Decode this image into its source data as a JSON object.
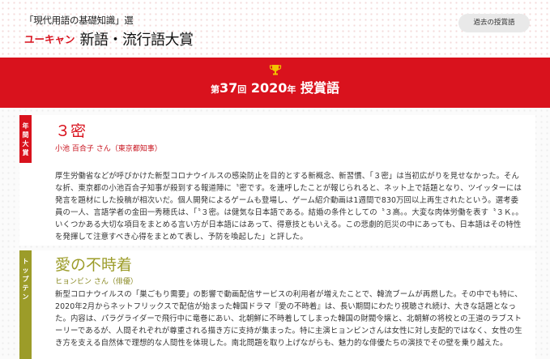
{
  "header": {
    "logo_subtitle": "「現代用語の基礎知識」選",
    "logo_brand": "ユーキャン",
    "logo_title": "新語・流行語大賞",
    "past_awards_button": "過去の授賞語"
  },
  "banner": {
    "edition_prefix": "第",
    "edition_number": "37",
    "edition_suffix": "回",
    "year": "2020",
    "year_suffix": "年",
    "title": "授賞語",
    "icon": "trophy-icon"
  },
  "colors": {
    "brand_red": "#d9121d",
    "olive": "#9c9c29"
  },
  "awards": [
    {
      "category_label": [
        "年",
        "間",
        "大",
        "賞"
      ],
      "word": "３密",
      "winner": "小池 百合子 さん（東京都知事）",
      "description": "厚生労働省などが呼びかけた新型コロナウイルスの感染防止を目的とする新概念、新習慣、「３密」は当初広がりを見せなかった。そんな折、東京都の小池百合子知事が殺到する報道陣に〝密です。を連呼したことが報じられると、ネット上で話題となり、ツイッターには発言を題材にした投稿が相次いだ。個人開発によるゲームも登場し、ゲーム紹介動画は1週間で830万回以上再生されたという。選考委員の一人、言語学者の金田一秀穂氏は、「〝３密。は健気な日本語である。結婚の条件としての〝３高。。大変な肉体労働を表す〝３Ｋ。。いくつかある大切な項目をまとめる言い方が日本語にはあって、得意技ともいえる。この悲劇的厄災の中にあっても、日本語はその特性を発揮して注意すべき心得をまとめて表し、予防を喚起した」と評した。"
    },
    {
      "category_label": [
        "ト",
        "ッ",
        "プ",
        "テ",
        "ン"
      ],
      "word": "愛の不時着",
      "winner": "ヒョンビン さん（俳優）",
      "description": "新型コロナウイルスの「巣ごもり需要」の影響で動画配信サービスの利用者が増えたことで、韓流ブームが再燃した。その中でも特に、2020年2月からネットフリックスで配信が始まった韓国ドラマ『愛の不時着』は、長い期間にわたり視聴され続け、大きな話題となった。内容は、パラグライダーで飛行中に竜巻にあい、北朝鮮に不時着してしまった韓国の財閥令嬢と、北朝鮮の将校との王道のラブストーリーであるが、人間それぞれが尊重される描き方に支持が集まった。特に主演ヒョンビンさんは女性に対し支配的ではなく、女性の生き方を支える自然体で理想的な人間性を体現した。南北問題を取り上げながらも、魅力的な俳優たちの演技でその壁を乗り越えた。"
    }
  ]
}
